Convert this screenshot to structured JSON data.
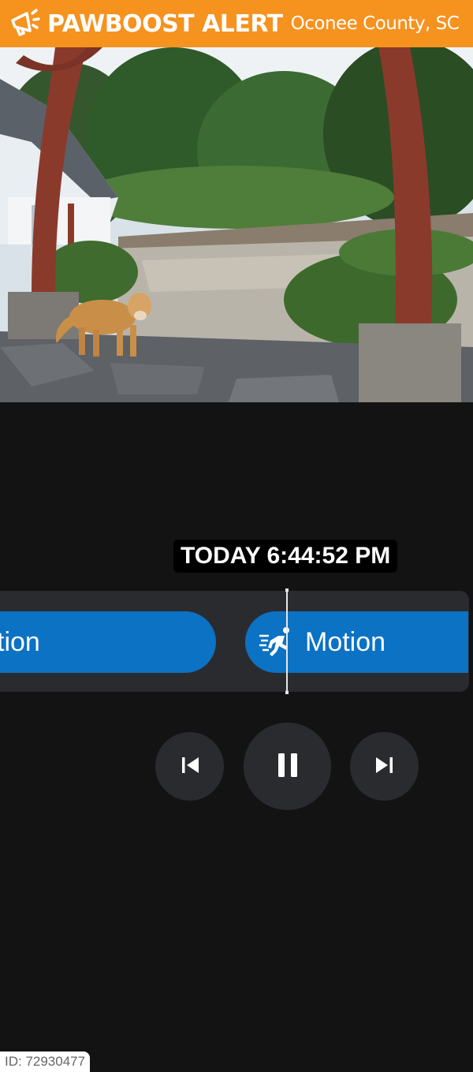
{
  "banner": {
    "icon": "megaphone-icon",
    "title": "PAWBOOST ALERT",
    "location": "Oconee County, SC",
    "color": "#f6921e"
  },
  "player": {
    "timestamp": "TODAY 6:44:52 PM",
    "events": [
      {
        "label": "tion",
        "icon": ""
      },
      {
        "label": "Motion",
        "icon": "running-person-icon"
      }
    ],
    "accent": "#0b72c4",
    "controls": [
      "previous-icon",
      "pause-icon",
      "next-icon"
    ]
  },
  "footer": {
    "id_text": "ID: 72930477"
  }
}
